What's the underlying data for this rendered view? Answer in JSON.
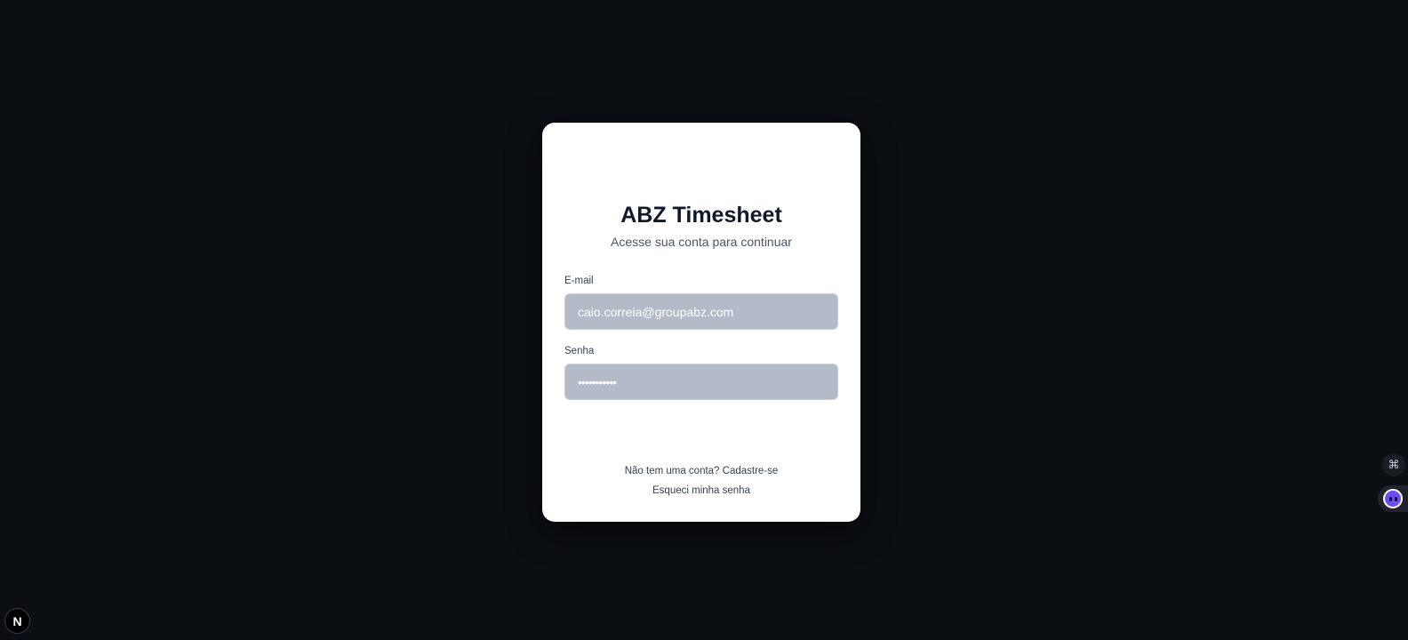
{
  "login": {
    "title": "ABZ Timesheet",
    "subtitle": "Acesse sua conta para continuar",
    "email_label": "E-mail",
    "email_value": "caio.correia@groupabz.com",
    "password_label": "Senha",
    "password_value": "•••••••••••",
    "signup_text": "Não tem uma conta? Cadastre-se",
    "forgot_text": "Esqueci minha senha"
  },
  "overlay": {
    "n_badge": "N",
    "tool_icon": "⌘"
  },
  "colors": {
    "background": "#0b0e13",
    "card": "#ffffff",
    "field": "#b3bac8",
    "accent": "#6d4df0"
  },
  "icons": [
    "command-icon",
    "bot-assistant-icon",
    "next-dev-badge-icon"
  ]
}
